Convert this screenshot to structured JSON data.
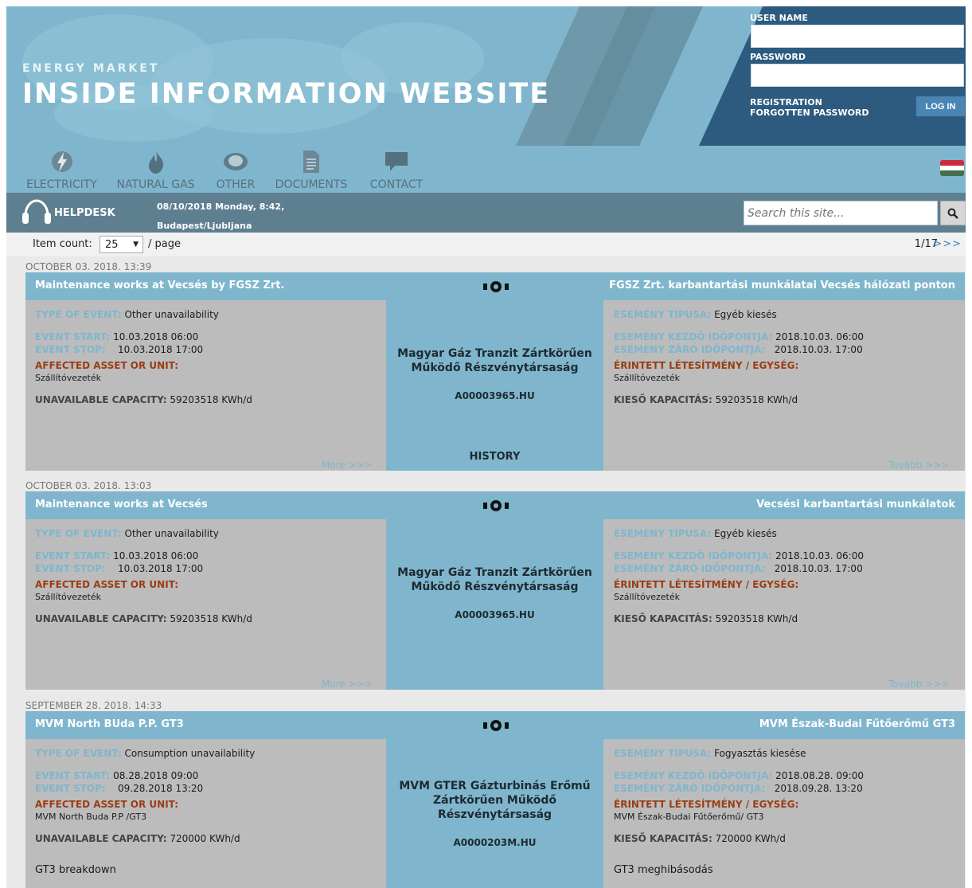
{
  "header": {
    "brand_sub": "ENERGY MARKET",
    "brand_title": "INSIDE INFORMATION WEBSITE",
    "username_label": "USER NAME",
    "password_label": "PASSWORD",
    "registration": "REGISTRATION",
    "forgotten": "FORGOTTEN PASSWORD",
    "login_btn": "LOG IN"
  },
  "nav": [
    {
      "label": "ELECTRICITY",
      "icon": "lightning-icon"
    },
    {
      "label": "NATURAL GAS",
      "icon": "flame-icon"
    },
    {
      "label": "OTHER",
      "icon": "circle-icon"
    },
    {
      "label": "DOCUMENTS",
      "icon": "document-icon"
    },
    {
      "label": "CONTACT",
      "icon": "speech-bubble-icon"
    }
  ],
  "flag_colors": [
    "#cd2a3e",
    "#ffffff",
    "#436f4d"
  ],
  "helpbar": {
    "helpdesk": "HELPDESK",
    "date": "08/10/2018 Monday, 8:42,",
    "location": "Budapest/Ljubljana",
    "search_placeholder": "Search this site..."
  },
  "list": {
    "item_count_label": "Item count:",
    "item_count_value": "25",
    "per_page": "/ page",
    "pager": "1/17",
    "next": ">>>"
  },
  "labels_en": {
    "type": "TYPE OF EVENT:",
    "start": "EVENT START:",
    "stop": "EVENT STOP:",
    "asset": "AFFECTED ASSET OR UNIT:",
    "capacity": "UNAVAILABLE CAPACITY:",
    "more": "More >>>"
  },
  "labels_hu": {
    "type": "ESEMÉNY TÍPUSA:",
    "start": "ESEMÉNY KEZDŐ IDŐPONTJA:",
    "stop": "ESEMÉNY ZÁRÓ IDŐPONTJA:",
    "asset": "ÉRINTETT LÉTESÍTMÉNY / EGYSÉG:",
    "capacity": "KIESŐ KAPACITÁS:",
    "more": "Tovább >>>"
  },
  "events": [
    {
      "timestamp": "OCTOBER 03. 2018. 13:39",
      "title_en": "Maintenance works at Vecsés by FGSZ Zrt.",
      "title_hu": "FGSZ Zrt. karbantartási munkálatai Vecsés hálózati ponton",
      "company_line1": "Magyar Gáz Tranzit Zártkörűen",
      "company_line2": "Működő Részvénytársaság",
      "company_line3": "",
      "code": "A00003965.HU",
      "history": "HISTORY",
      "type_en": "Other unavailability",
      "type_hu": "Egyéb kiesés",
      "start_en": "10.03.2018 06:00",
      "stop_en": "10.03.2018 17:00",
      "start_hu": "2018.10.03. 06:00",
      "stop_hu": "2018.10.03. 17:00",
      "asset_en": "Szállítóvezeték",
      "asset_hu": "Szállítóvezeték",
      "capacity": "59203518 KWh/d",
      "note_en": "",
      "note_hu": ""
    },
    {
      "timestamp": "OCTOBER 03. 2018. 13:03",
      "title_en": "Maintenance works at Vecsés",
      "title_hu": "Vecsési karbantartási munkálatok",
      "company_line1": "Magyar Gáz Tranzit Zártkörűen",
      "company_line2": "Működő Részvénytársaság",
      "company_line3": "",
      "code": "A00003965.HU",
      "history": "",
      "type_en": "Other unavailability",
      "type_hu": "Egyéb kiesés",
      "start_en": "10.03.2018 06:00",
      "stop_en": "10.03.2018 17:00",
      "start_hu": "2018.10.03. 06:00",
      "stop_hu": "2018.10.03. 17:00",
      "asset_en": "Szállítóvezeték",
      "asset_hu": "Szállítóvezeték",
      "capacity": "59203518 KWh/d",
      "note_en": "",
      "note_hu": ""
    },
    {
      "timestamp": "SEPTEMBER 28. 2018. 14:33",
      "title_en": "MVM North BUda P.P. GT3",
      "title_hu": "MVM Észak-Budai Fűtőerőmű GT3",
      "company_line1": "MVM GTER Gázturbinás Erőmű",
      "company_line2": "Zártkörűen Működő",
      "company_line3": "Részvénytársaság",
      "code": "A0000203M.HU",
      "history": "",
      "type_en": "Consumption unavailability",
      "type_hu": "Fogyasztás kiesése",
      "start_en": "08.28.2018 09:00",
      "stop_en": "09.28.2018 13:20",
      "start_hu": "2018.08.28. 09:00",
      "stop_hu": "2018.09.28. 13:20",
      "asset_en": "MVM North Buda P.P /GT3",
      "asset_hu": "MVM Észak-Budai Fűtőerőmű/ GT3",
      "capacity": "720000 KWh/d",
      "note_en": "GT3 breakdown",
      "note_hu": "GT3 meghibásodás"
    }
  ]
}
